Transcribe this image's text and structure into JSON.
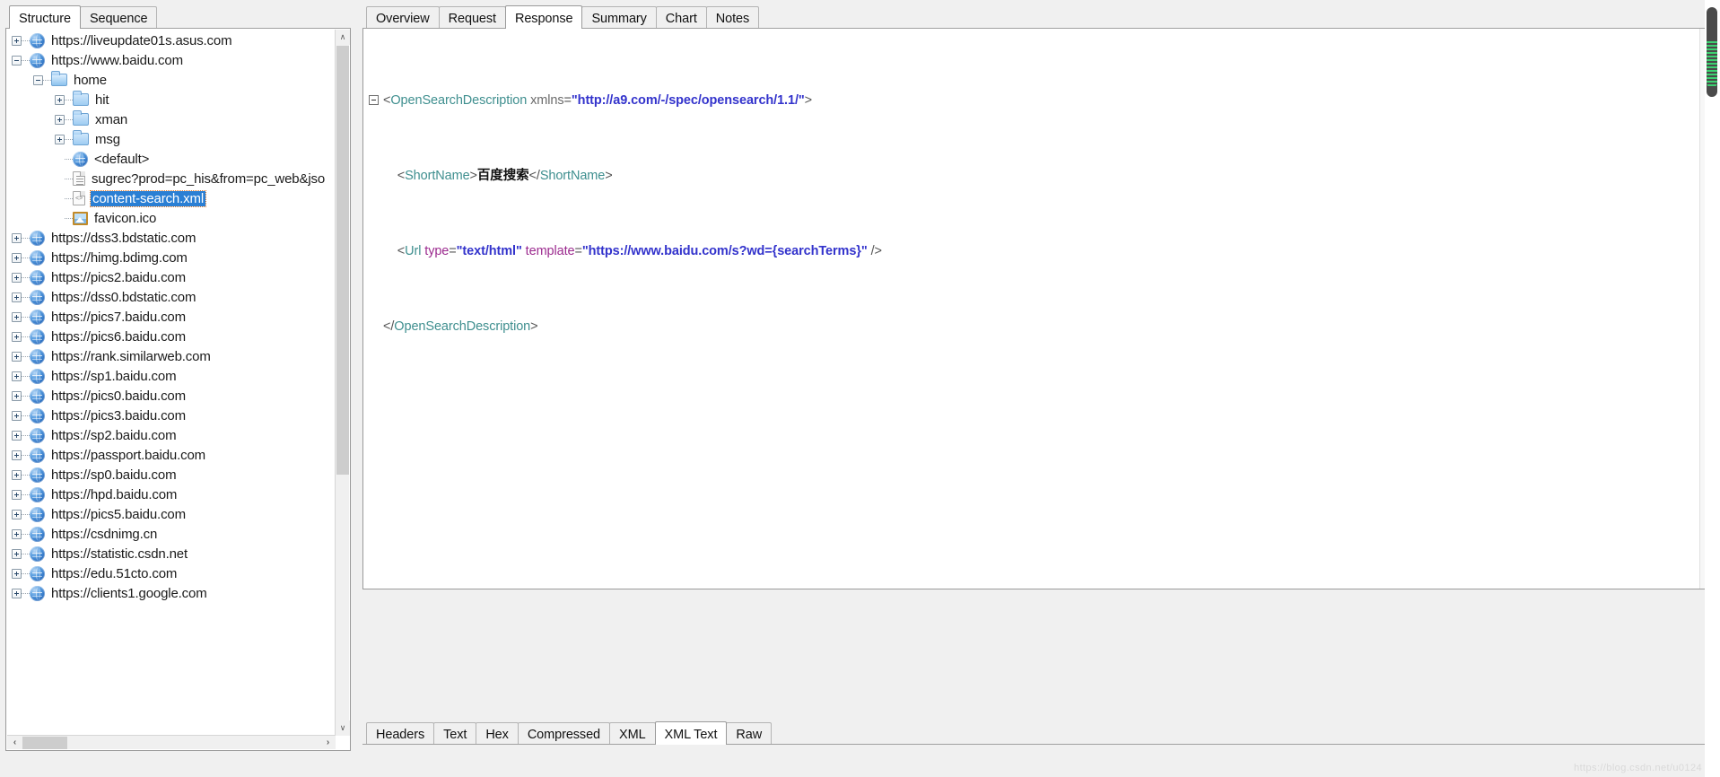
{
  "left_panel": {
    "tabs": [
      {
        "label": "Structure",
        "active": true
      },
      {
        "label": "Sequence",
        "active": false
      }
    ],
    "tree": [
      {
        "indent": 0,
        "expander": "plus",
        "icon": "globe",
        "label": "https://liveupdate01s.asus.com",
        "selected": false
      },
      {
        "indent": 0,
        "expander": "minus",
        "icon": "globe",
        "label": "https://www.baidu.com",
        "selected": false
      },
      {
        "indent": 1,
        "expander": "minus",
        "icon": "folder-open",
        "label": "home",
        "selected": false
      },
      {
        "indent": 2,
        "expander": "plus",
        "icon": "folder",
        "label": "hit",
        "selected": false
      },
      {
        "indent": 2,
        "expander": "plus",
        "icon": "folder",
        "label": "xman",
        "selected": false
      },
      {
        "indent": 2,
        "expander": "plus",
        "icon": "folder",
        "label": "msg",
        "selected": false
      },
      {
        "indent": 2,
        "expander": "none",
        "icon": "globe",
        "label": "<default>",
        "selected": false
      },
      {
        "indent": 2,
        "expander": "none",
        "icon": "doc",
        "label": "sugrec?prod=pc_his&from=pc_web&jso",
        "selected": false
      },
      {
        "indent": 2,
        "expander": "none",
        "icon": "code",
        "label": "content-search.xml",
        "selected": true
      },
      {
        "indent": 2,
        "expander": "none",
        "icon": "image",
        "label": "favicon.ico",
        "selected": false
      },
      {
        "indent": 0,
        "expander": "plus",
        "icon": "globe",
        "label": "https://dss3.bdstatic.com",
        "selected": false
      },
      {
        "indent": 0,
        "expander": "plus",
        "icon": "globe",
        "label": "https://himg.bdimg.com",
        "selected": false
      },
      {
        "indent": 0,
        "expander": "plus",
        "icon": "globe",
        "label": "https://pics2.baidu.com",
        "selected": false
      },
      {
        "indent": 0,
        "expander": "plus",
        "icon": "globe",
        "label": "https://dss0.bdstatic.com",
        "selected": false
      },
      {
        "indent": 0,
        "expander": "plus",
        "icon": "globe",
        "label": "https://pics7.baidu.com",
        "selected": false
      },
      {
        "indent": 0,
        "expander": "plus",
        "icon": "globe",
        "label": "https://pics6.baidu.com",
        "selected": false
      },
      {
        "indent": 0,
        "expander": "plus",
        "icon": "globe",
        "label": "https://rank.similarweb.com",
        "selected": false
      },
      {
        "indent": 0,
        "expander": "plus",
        "icon": "globe",
        "label": "https://sp1.baidu.com",
        "selected": false
      },
      {
        "indent": 0,
        "expander": "plus",
        "icon": "globe",
        "label": "https://pics0.baidu.com",
        "selected": false
      },
      {
        "indent": 0,
        "expander": "plus",
        "icon": "globe",
        "label": "https://pics3.baidu.com",
        "selected": false
      },
      {
        "indent": 0,
        "expander": "plus",
        "icon": "globe",
        "label": "https://sp2.baidu.com",
        "selected": false
      },
      {
        "indent": 0,
        "expander": "plus",
        "icon": "globe",
        "label": "https://passport.baidu.com",
        "selected": false
      },
      {
        "indent": 0,
        "expander": "plus",
        "icon": "globe",
        "label": "https://sp0.baidu.com",
        "selected": false
      },
      {
        "indent": 0,
        "expander": "plus",
        "icon": "globe",
        "label": "https://hpd.baidu.com",
        "selected": false
      },
      {
        "indent": 0,
        "expander": "plus",
        "icon": "globe",
        "label": "https://pics5.baidu.com",
        "selected": false
      },
      {
        "indent": 0,
        "expander": "plus",
        "icon": "globe",
        "label": "https://csdnimg.cn",
        "selected": false
      },
      {
        "indent": 0,
        "expander": "plus",
        "icon": "globe",
        "label": "https://statistic.csdn.net",
        "selected": false
      },
      {
        "indent": 0,
        "expander": "plus",
        "icon": "globe",
        "label": "https://edu.51cto.com",
        "selected": false
      },
      {
        "indent": 0,
        "expander": "plus",
        "icon": "globe",
        "label": "https://clients1.google.com",
        "selected": false
      }
    ],
    "scrollbar": {
      "up_arrow": "∧",
      "down_arrow": "∨",
      "left_arrow": "‹",
      "right_arrow": "›"
    }
  },
  "right_panel": {
    "top_tabs": [
      {
        "label": "Overview",
        "active": false
      },
      {
        "label": "Request",
        "active": false
      },
      {
        "label": "Response",
        "active": true
      },
      {
        "label": "Summary",
        "active": false
      },
      {
        "label": "Chart",
        "active": false
      },
      {
        "label": "Notes",
        "active": false
      }
    ],
    "bottom_tabs": [
      {
        "label": "Headers",
        "active": false
      },
      {
        "label": "Text",
        "active": false
      },
      {
        "label": "Hex",
        "active": false
      },
      {
        "label": "Compressed",
        "active": false
      },
      {
        "label": "XML",
        "active": false
      },
      {
        "label": "XML Text",
        "active": true
      },
      {
        "label": "Raw",
        "active": false
      }
    ],
    "xml": {
      "line1": {
        "open": "<",
        "tag": "OpenSearchDescription",
        "attr_name": "xmlns",
        "eq": "=",
        "attr_value": "\"http://a9.com/-/spec/opensearch/1.1/\"",
        "close": ">"
      },
      "line2": {
        "open_lt": "<",
        "tag": "ShortName",
        "open_gt": ">",
        "text": "百度搜索",
        "close_lt": "</",
        "close_tag": "ShortName",
        "close_gt": ">"
      },
      "line3": {
        "open": "<",
        "tag": "Url",
        "attr1_name": "type",
        "attr1_value": "\"text/html\"",
        "attr2_name": "template",
        "attr2_value": "\"https://www.baidu.com/s?wd={searchTerms}\"",
        "close": "/>"
      },
      "line4": {
        "open": "</",
        "tag": "OpenSearchDescription",
        "close": ">"
      }
    }
  },
  "watermark": "https://blog.csdn.net/u0124"
}
